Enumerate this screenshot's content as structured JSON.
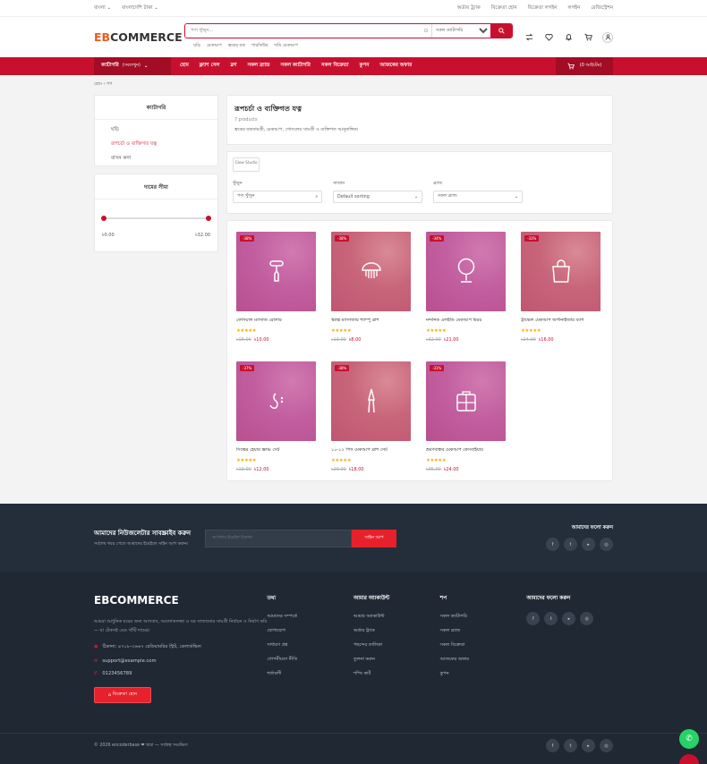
{
  "topbar": {
    "language": "বাংলা",
    "currency": "বাংলাদেশি টাকা",
    "links": [
      "অর্ডার ট্র্যাক",
      "বিক্রেতা হোন",
      "বিক্রেতা লগইন",
      "লগইন",
      "রেজিস্ট্রেশন"
    ]
  },
  "header": {
    "logo_accent": "EB",
    "logo_rest": "COMMERCE",
    "search_placeholder": "পণ্য খুঁজুন...",
    "search_category": "সকল ক্যাটাগরি",
    "popular_tags": [
      "ঘড়ি",
      "মেকআপ",
      "ত্বকের যত্ন",
      "পারফিউম",
      "দামি মেকআপ"
    ]
  },
  "nav": {
    "categories_label": "ক্যাটাগরি",
    "categories_sub": "(সবদেখুন)",
    "links": [
      "হোম",
      "ফ্ল্যাশ সেল",
      "ব্লগ",
      "সকল ব্র্যান্ড",
      "সকল ক্যাটাগরি",
      "সকল বিক্রেতা",
      "কুপন",
      "আজকের অফার"
    ],
    "cart_label": "(0 আইটেম)"
  },
  "breadcrumb": [
    "হোম",
    "শপ"
  ],
  "sidebar": {
    "category_title": "ক্যাটাগরি",
    "categories": [
      "ঘড়ি",
      "রূপচর্চা ও ব্যক্তিগত যত্ন",
      "বাসন কসা"
    ],
    "price_title": "দামের সীমা",
    "price_min": "৳0.00",
    "price_max": "৳32.00"
  },
  "listing": {
    "title": "রূপচর্চা ও ব্যক্তিগত যত্ন",
    "count": "7 products",
    "description": "ত্বকের যত্নসামগ্রী, মেকআপ, গোসলের সামগ্রী ও ব্যক্তিগত আনুষাঙ্গিক।",
    "brand_tag": "Glow Studio",
    "filter_search_label": "খুঁজুন",
    "filter_search_placeholder": "পণ্য খুঁজুন",
    "filter_sort_label": "সাজান",
    "filter_sort_value": "Default sorting",
    "filter_brand_label": "ব্র্যান্ড",
    "filter_brand_value": "সকল ব্র্যান্ড"
  },
  "products": [
    {
      "name": "ফেসিয়াল ম্যাসাজ রোলার",
      "discount": "-38%",
      "old": "৳16.00",
      "price": "৳10.00",
      "icon": "roller-icon",
      "rating": 5
    },
    {
      "name": "স্ক্যাল্প ম্যাসাজার শ্যাম্পু ব্রাশ",
      "discount": "-38%",
      "old": "৳13.00",
      "price": "৳8.00",
      "icon": "brush-icon",
      "rating": 5
    },
    {
      "name": "নন্দনিক এলইডি মেকআপ মিরর",
      "discount": "-34%",
      "old": "৳32.00",
      "price": "৳21.00",
      "icon": "mirror-icon",
      "rating": 5
    },
    {
      "name": "ট্রাভেল মেকআপ অর্গানাইজার ব্যাগ",
      "discount": "-33%",
      "old": "৳24.00",
      "price": "৳16.00",
      "icon": "bag-icon",
      "rating": 5
    },
    {
      "name": "সিল্কের হেয়ার স্ক্রাঞ্চ সেট",
      "discount": "-37%",
      "old": "৳19.00",
      "price": "৳12.00",
      "icon": "scrunchie-icon",
      "rating": 5
    },
    {
      "name": "১০-১২ পিস মেকআপ ব্রাশ সেট",
      "discount": "-38%",
      "old": "৳29.00",
      "price": "৳18.00",
      "icon": "brushes-icon",
      "rating": 5
    },
    {
      "name": "ভ্রমণবান্ধব মেকআপ কেসবাইযার",
      "discount": "-31%",
      "old": "৳35.00",
      "price": "৳24.00",
      "icon": "case-icon",
      "rating": 5
    }
  ],
  "newsletter": {
    "heading": "আমাদের নিউজলেটার সাবস্ক্রাইব করুন",
    "sub": "সর্বশেষ খবর পেতে আমাদের ইমেইলে সাইন আপ করুন।",
    "placeholder": "আপনার ইমেইল ঠিকানা",
    "button": "সাইন আপ",
    "follow": "আমাদের ফলো করুন"
  },
  "footer": {
    "logo": "EBCOMMERCE",
    "description": "আমরা আধুনিক ঘরের জন্য আসবাব, আলোকসজ্জা ও ঘর সাজানোর সামগ্রী নির্বাচন ও নির্মাণ করি — যা টেকসই এবং খাঁটি দামের।",
    "address": "ঠিকানা: ৪৭১৮-৩৬৬৭ রেডিয়ামরির স্ট্রিট, ডেলার্ডভিল",
    "email": "support@example.com",
    "phone": "0123456789",
    "shop_button": "বিক্রেতা হোন",
    "col1_title": "তথ্য",
    "col1": [
      "আমাদের সম্পর্কে",
      "যোগাযোগ",
      "সাধারণ প্রশ্ন",
      "গোপনীয়তা নীতি",
      "শর্তাবলী"
    ],
    "col2_title": "আমার অ্যাকাউন্ট",
    "col2": [
      "আমার অ্যাকাউন্ট",
      "অর্ডার ট্র্যাক",
      "পছন্দের তালিকা",
      "তুলনা করুন",
      "শপিং কার্ট"
    ],
    "col3_title": "শপ",
    "col3": [
      "সকল ক্যাটাগরি",
      "সকল ব্র্যান্ড",
      "সকল বিক্রেতা",
      "আজকের অফার",
      "কুপন"
    ],
    "col4_title": "আমাদের ফলো করুন",
    "copyright": "© 2026 encoderbase ❤ দ্বারা — সর্বস্বত্ব সংরক্ষিত"
  },
  "colors": {
    "primary": "#c8102e",
    "accent_orange": "#e85d1a",
    "footer_bg": "#1f2833",
    "whatsapp": "#25d366"
  }
}
